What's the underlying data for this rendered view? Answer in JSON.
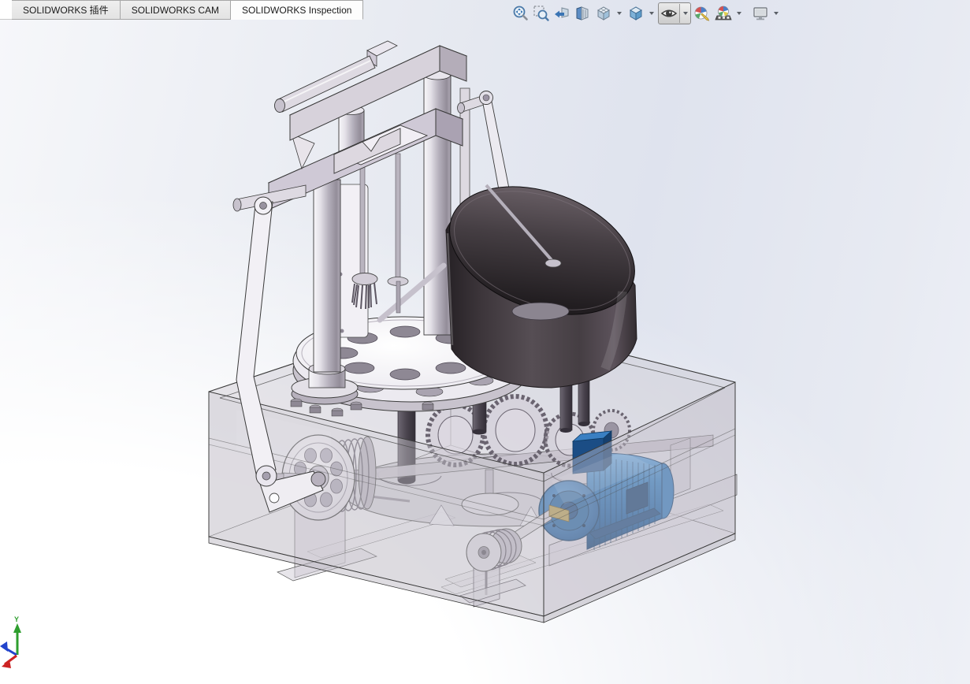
{
  "app": {
    "name": "SOLIDWORKS"
  },
  "tab_bar": {
    "tabs": [
      {
        "label": "SOLIDWORKS 插件",
        "active": false
      },
      {
        "label": "SOLIDWORKS CAM",
        "active": false
      },
      {
        "label": "SOLIDWORKS Inspection",
        "active": true
      }
    ]
  },
  "heads_up_toolbar": {
    "buttons": [
      {
        "name": "zoom-to-fit"
      },
      {
        "name": "zoom-to-area"
      },
      {
        "name": "previous-view"
      },
      {
        "name": "section-view"
      },
      {
        "name": "view-orientation",
        "has_dropdown": true
      },
      {
        "name": "display-style",
        "has_dropdown": true
      },
      {
        "name": "hide-show-items",
        "has_dropdown": true,
        "pressed": true
      },
      {
        "name": "edit-appearance"
      },
      {
        "name": "apply-scene",
        "has_dropdown": true
      },
      {
        "name": "view-settings",
        "has_dropdown": true
      }
    ]
  },
  "viewport": {
    "background_gradient": [
      "#f6f7fa",
      "#dfe3ee",
      "#ffffff"
    ],
    "model": {
      "description": "3D CAD assembly of a rotary briquette/tablet press machine",
      "parts": [
        "press-frame-tower",
        "upper-beam",
        "crosshead-beam",
        "guide-columns",
        "rotary-table",
        "feed-hopper",
        "transparent-enclosure",
        "gear-train",
        "geneva-plate",
        "flywheel-pulley",
        "crank-linkage",
        "drive-motor",
        "v-belt-pulley",
        "drive-shaft",
        "column-flange"
      ],
      "colors": {
        "metal_light": "#f0eef3",
        "metal_lavender": "#cfc9d6",
        "hopper_dark": "#3a3338",
        "motor_blue": "#1f6cb0",
        "enclosure_glass": "rgba(200,196,205,0.42)"
      }
    },
    "triad": {
      "y_label": "Y",
      "x_color": "#cc2222",
      "y_color": "#2e9e2e",
      "z_color": "#2244cc"
    }
  }
}
